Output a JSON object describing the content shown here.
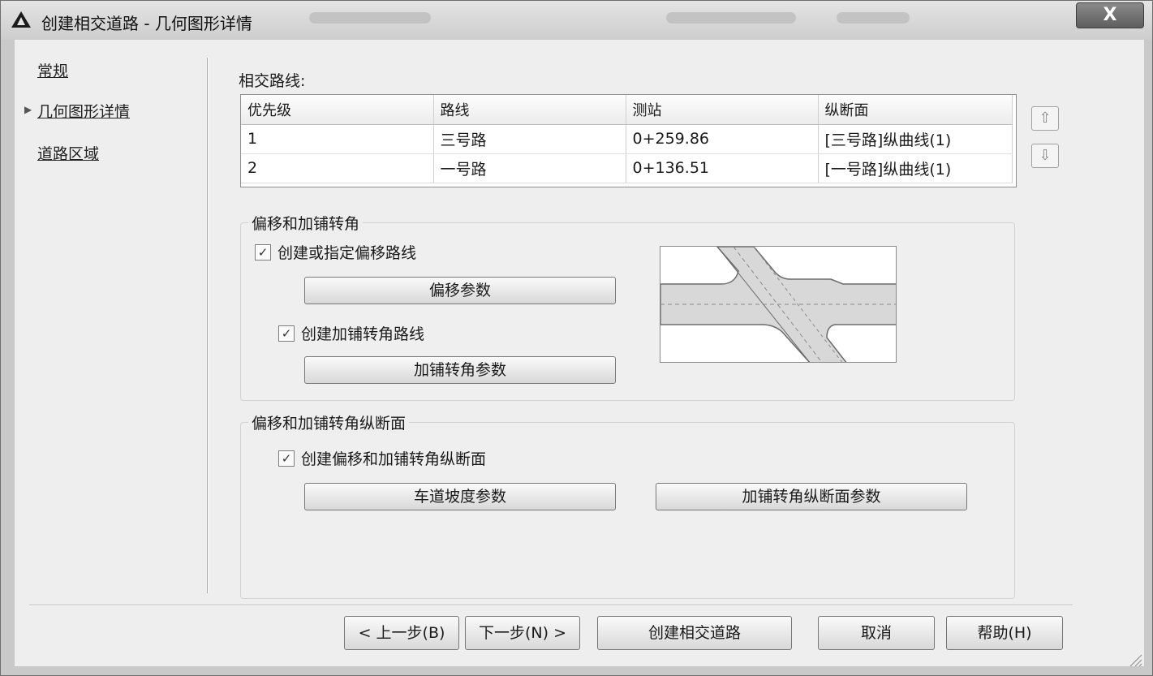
{
  "window": {
    "title": "创建相交道路 - 几何图形详情",
    "close_label": "X"
  },
  "nav": {
    "items": [
      {
        "label": "常规"
      },
      {
        "label": "几何图形详情"
      },
      {
        "label": "道路区域"
      }
    ]
  },
  "intersecting_alignments": {
    "label": "相交路线:",
    "columns": [
      "优先级",
      "路线",
      "测站",
      "纵断面"
    ],
    "rows": [
      [
        "1",
        "三号路",
        "0+259.86",
        "[三号路]纵曲线(1)"
      ],
      [
        "2",
        "一号路",
        "0+136.51",
        "[一号路]纵曲线(1)"
      ]
    ],
    "move_up_icon": "arrow-up-icon",
    "move_down_icon": "arrow-down-icon"
  },
  "offset_group": {
    "title": "偏移和加铺转角",
    "create_offset_checkbox": {
      "label": "创建或指定偏移路线",
      "checked": true
    },
    "offset_params_button": "偏移参数",
    "create_curb_return_checkbox": {
      "label": "创建加铺转角路线",
      "checked": true
    },
    "curb_return_params_button": "加铺转角参数"
  },
  "profile_group": {
    "title": "偏移和加铺转角纵断面",
    "create_profiles_checkbox": {
      "label": "创建偏移和加铺转角纵断面",
      "checked": true
    },
    "lane_slope_button": "车道坡度参数",
    "curb_return_profile_button": "加铺转角纵断面参数"
  },
  "footer": {
    "back_button": "< 上一步(B)",
    "next_button": "下一步(N) >",
    "create_button": "创建相交道路",
    "cancel_button": "取消",
    "help_button": "帮助(H)"
  }
}
